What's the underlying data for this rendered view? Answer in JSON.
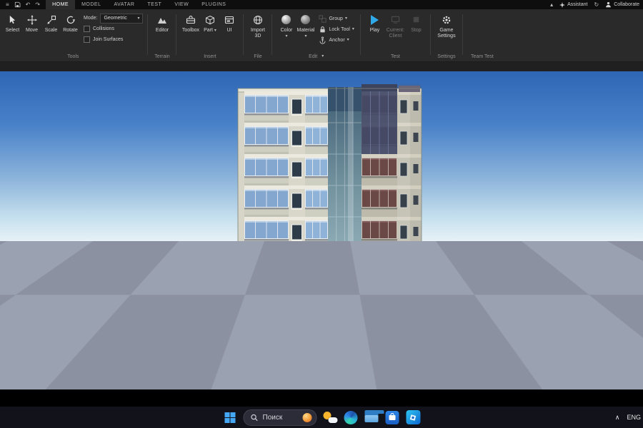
{
  "icons": {
    "menu": "≡",
    "undo": "↶",
    "redo": "↷",
    "sync": "↻",
    "caret": "▾",
    "launcher": "▾",
    "ribbon_collapse": "▴",
    "chevron_up": "∧"
  },
  "titlebar": {
    "tabs": [
      "HOME",
      "MODEL",
      "AVATAR",
      "TEST",
      "VIEW",
      "PLUGINS"
    ],
    "active_tab": "HOME",
    "assistant": "Assistant",
    "collaborate": "Collaborate"
  },
  "ribbon": {
    "tools": {
      "label": "Tools",
      "select": "Select",
      "move": "Move",
      "scale": "Scale",
      "rotate": "Rotate",
      "mode_label": "Mode:",
      "mode_value": "Geometric",
      "collisions": "Collisions",
      "join_surfaces": "Join Surfaces"
    },
    "terrain": {
      "label": "Terrain",
      "editor": "Editor"
    },
    "insert": {
      "label": "Insert",
      "toolbox": "Toolbox",
      "part": "Part",
      "ui": "UI"
    },
    "file": {
      "label": "File",
      "import_line1": "Import",
      "import_line2": "3D"
    },
    "edit": {
      "label": "Edit",
      "color": "Color",
      "material": "Material",
      "group": "Group",
      "lock_tool": "Lock Tool",
      "anchor": "Anchor"
    },
    "test": {
      "label": "Test",
      "play": "Play",
      "current_line1": "Current:",
      "current_line2": "Client",
      "stop": "Stop"
    },
    "settings": {
      "label": "Settings",
      "game_line1": "Game",
      "game_line2": "Settings"
    },
    "team_test": {
      "label": "Team Test"
    }
  },
  "taskbar": {
    "search": "Поиск",
    "language": "ENG"
  }
}
